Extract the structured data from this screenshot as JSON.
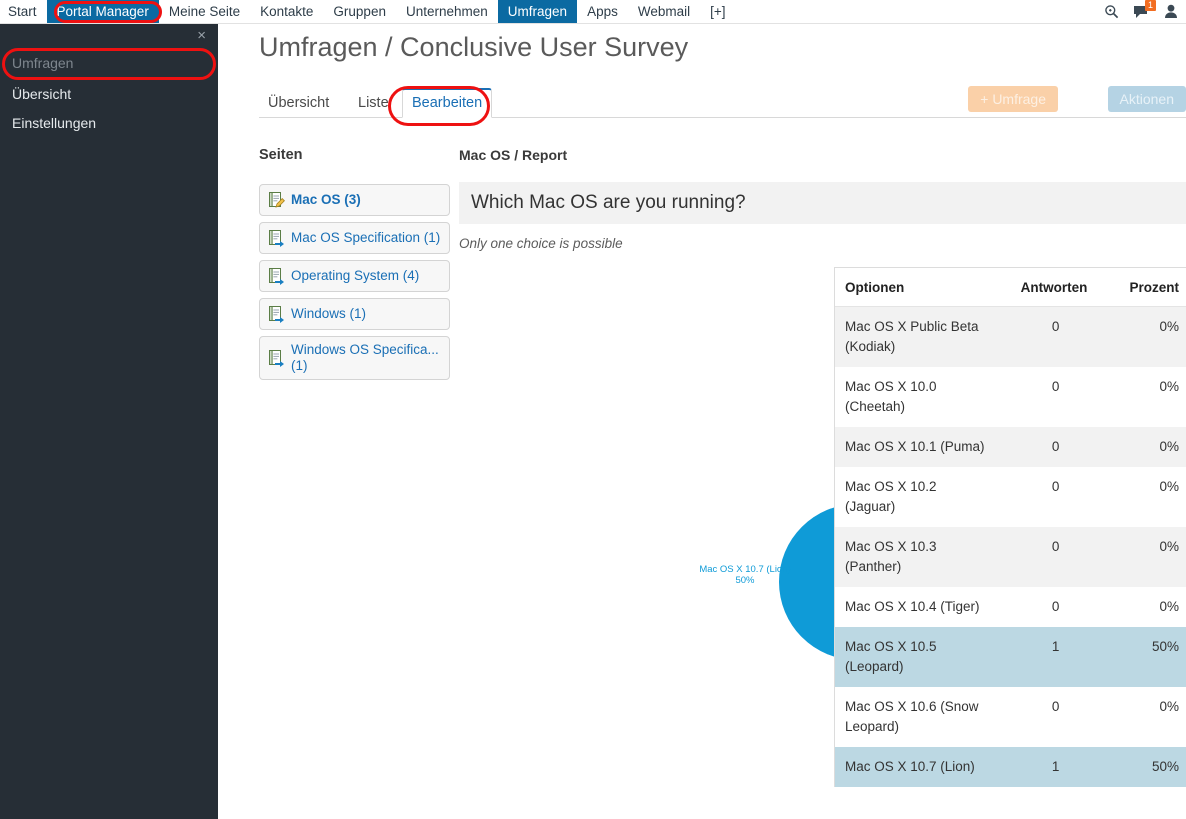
{
  "topnav": {
    "items": [
      {
        "label": "Start",
        "active": false
      },
      {
        "label": "Portal Manager",
        "active": true
      },
      {
        "label": "Meine Seite",
        "active": false
      },
      {
        "label": "Kontakte",
        "active": false
      },
      {
        "label": "Gruppen",
        "active": false
      },
      {
        "label": "Unternehmen",
        "active": false
      },
      {
        "label": "Umfragen",
        "active": true
      },
      {
        "label": "Apps",
        "active": false
      },
      {
        "label": "Webmail",
        "active": false
      },
      {
        "label": "[+]",
        "active": false
      }
    ],
    "icons": {
      "search": "search-icon",
      "messages": "chat-icon",
      "messages_badge": "1",
      "user": "user-icon"
    }
  },
  "drawer": {
    "close": "×",
    "title": "Umfragen",
    "links": [
      {
        "label": "Übersicht"
      },
      {
        "label": "Einstellungen"
      }
    ]
  },
  "header": {
    "title": "Umfragen / Conclusive User Survey"
  },
  "tabs": [
    {
      "label": "Übersicht",
      "active": false
    },
    {
      "label": "Liste",
      "active": false
    },
    {
      "label": "Bearbeiten",
      "active": true
    }
  ],
  "actions": {
    "new_survey": "+ Umfrage",
    "actions": "Aktionen"
  },
  "pages_panel": {
    "heading": "Seiten",
    "items": [
      {
        "label": "Mac OS (3)",
        "active": true,
        "icon": "page-edit-icon"
      },
      {
        "label": "Mac OS Specification (1)",
        "active": false,
        "icon": "page-goto-icon"
      },
      {
        "label": "Operating System (4)",
        "active": false,
        "icon": "page-goto-icon"
      },
      {
        "label": "Windows (1)",
        "active": false,
        "icon": "page-goto-icon"
      },
      {
        "label": "Windows OS Specifica... (1)",
        "active": false,
        "icon": "page-goto-icon"
      }
    ]
  },
  "report": {
    "heading": "Mac OS / Report",
    "question": "Which Mac OS are you running?",
    "note": "Only one choice is possible",
    "table": {
      "columns": [
        "Optionen",
        "Antworten",
        "Prozent"
      ],
      "rows": [
        {
          "option": "Mac OS X Public Beta (Kodiak)",
          "answers": "0",
          "percent": "0%",
          "highlight": false
        },
        {
          "option": "Mac OS X 10.0 (Cheetah)",
          "answers": "0",
          "percent": "0%",
          "highlight": false
        },
        {
          "option": "Mac OS X 10.1 (Puma)",
          "answers": "0",
          "percent": "0%",
          "highlight": false
        },
        {
          "option": "Mac OS X 10.2 (Jaguar)",
          "answers": "0",
          "percent": "0%",
          "highlight": false
        },
        {
          "option": "Mac OS X 10.3 (Panther)",
          "answers": "0",
          "percent": "0%",
          "highlight": false
        },
        {
          "option": "Mac OS X 10.4 (Tiger)",
          "answers": "0",
          "percent": "0%",
          "highlight": false
        },
        {
          "option": "Mac OS X 10.5 (Leopard)",
          "answers": "1",
          "percent": "50%",
          "highlight": true
        },
        {
          "option": "Mac OS X 10.6 (Snow Leopard)",
          "answers": "0",
          "percent": "0%",
          "highlight": false
        },
        {
          "option": "Mac OS X 10.7 (Lion)",
          "answers": "1",
          "percent": "50%",
          "highlight": true
        }
      ]
    }
  },
  "chart_data": {
    "type": "pie",
    "title": "Which Mac OS are you running?",
    "labels": [
      "Mac OS X 10.7 (Lion)",
      "Mac OS X 10.5 (Leopard)"
    ],
    "values": [
      1,
      1
    ],
    "percent": [
      "50%",
      "50%"
    ],
    "colors": [
      "#0f9bd7",
      "#17365c"
    ],
    "label_texts": [
      "Mac OS X 10.7 (L\n50%",
      "Mac OS X 10.5\n(Leopard)\n50%"
    ],
    "legend": "none",
    "grid": false
  }
}
